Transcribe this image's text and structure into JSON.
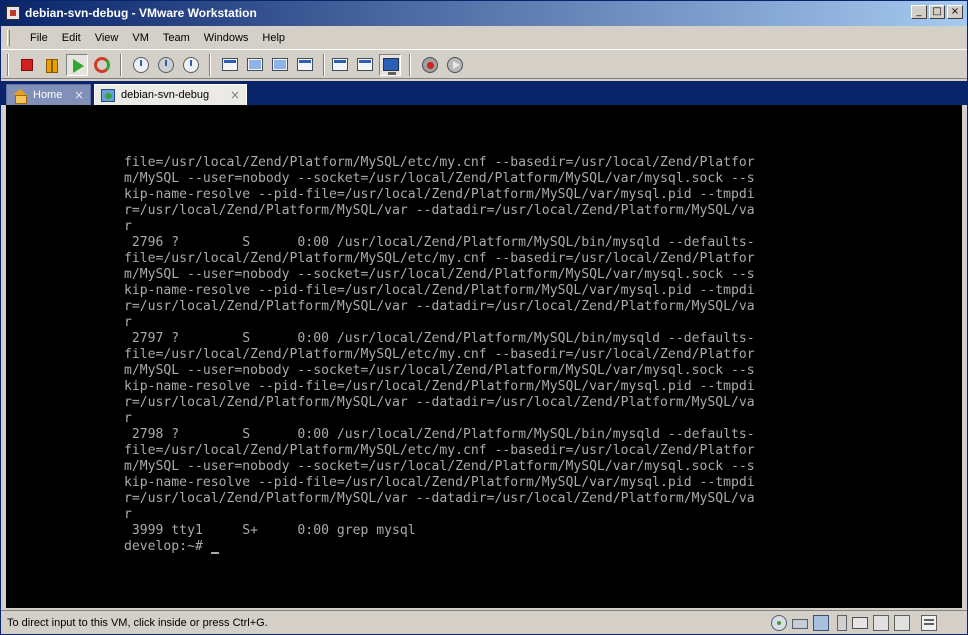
{
  "window": {
    "title": "debian-svn-debug - VMware Workstation",
    "controls": [
      "_",
      "□",
      "×"
    ]
  },
  "menu": [
    "File",
    "Edit",
    "View",
    "VM",
    "Team",
    "Windows",
    "Help"
  ],
  "toolbar": {
    "buttons": [
      {
        "name": "power-off",
        "icon": "stop-icon"
      },
      {
        "name": "suspend",
        "icon": "pause-icon"
      },
      {
        "name": "power-on",
        "icon": "play-icon",
        "pressed": true
      },
      {
        "name": "reset",
        "icon": "reset-icon"
      },
      {
        "name": "take-snapshot",
        "icon": "snapshot-icon"
      },
      {
        "name": "revert-snapshot",
        "icon": "revert-snapshot-icon"
      },
      {
        "name": "snapshot-manager",
        "icon": "snapshot-manager-icon"
      },
      {
        "name": "show-sidebar",
        "icon": "sidebar-icon"
      },
      {
        "name": "quick-switch",
        "icon": "quick-switch-icon"
      },
      {
        "name": "full-screen",
        "icon": "full-screen-icon"
      },
      {
        "name": "unity",
        "icon": "unity-icon"
      },
      {
        "name": "summary-view",
        "icon": "summary-icon"
      },
      {
        "name": "appliance-view",
        "icon": "appliance-icon"
      },
      {
        "name": "console-view",
        "icon": "console-icon",
        "pressed": true
      },
      {
        "name": "record",
        "icon": "record-icon"
      },
      {
        "name": "replay",
        "icon": "replay-icon"
      }
    ]
  },
  "tabs": [
    {
      "label": "Home",
      "icon": "home-icon",
      "active": false
    },
    {
      "label": "debian-svn-debug",
      "icon": "vm-icon",
      "active": true
    }
  ],
  "tab_close_glyph": "×",
  "console": {
    "lines": [
      "file=/usr/local/Zend/Platform/MySQL/etc/my.cnf --basedir=/usr/local/Zend/Platfor",
      "m/MySQL --user=nobody --socket=/usr/local/Zend/Platform/MySQL/var/mysql.sock --s",
      "kip-name-resolve --pid-file=/usr/local/Zend/Platform/MySQL/var/mysql.pid --tmpdi",
      "r=/usr/local/Zend/Platform/MySQL/var --datadir=/usr/local/Zend/Platform/MySQL/va",
      "r",
      " 2796 ?        S      0:00 /usr/local/Zend/Platform/MySQL/bin/mysqld --defaults-",
      "file=/usr/local/Zend/Platform/MySQL/etc/my.cnf --basedir=/usr/local/Zend/Platfor",
      "m/MySQL --user=nobody --socket=/usr/local/Zend/Platform/MySQL/var/mysql.sock --s",
      "kip-name-resolve --pid-file=/usr/local/Zend/Platform/MySQL/var/mysql.pid --tmpdi",
      "r=/usr/local/Zend/Platform/MySQL/var --datadir=/usr/local/Zend/Platform/MySQL/va",
      "r",
      " 2797 ?        S      0:00 /usr/local/Zend/Platform/MySQL/bin/mysqld --defaults-",
      "file=/usr/local/Zend/Platform/MySQL/etc/my.cnf --basedir=/usr/local/Zend/Platfor",
      "m/MySQL --user=nobody --socket=/usr/local/Zend/Platform/MySQL/var/mysql.sock --s",
      "kip-name-resolve --pid-file=/usr/local/Zend/Platform/MySQL/var/mysql.pid --tmpdi",
      "r=/usr/local/Zend/Platform/MySQL/var --datadir=/usr/local/Zend/Platform/MySQL/va",
      "r",
      " 2798 ?        S      0:00 /usr/local/Zend/Platform/MySQL/bin/mysqld --defaults-",
      "file=/usr/local/Zend/Platform/MySQL/etc/my.cnf --basedir=/usr/local/Zend/Platfor",
      "m/MySQL --user=nobody --socket=/usr/local/Zend/Platform/MySQL/var/mysql.sock --s",
      "kip-name-resolve --pid-file=/usr/local/Zend/Platform/MySQL/var/mysql.pid --tmpdi",
      "r=/usr/local/Zend/Platform/MySQL/var --datadir=/usr/local/Zend/Platform/MySQL/va",
      "r",
      " 3999 tty1     S+     0:00 grep mysql"
    ],
    "prompt": "develop:~# ",
    "text_color": "#aaaaaa",
    "background": "#000000"
  },
  "status": {
    "text": "To direct input to this VM, click inside or press Ctrl+G.",
    "device_icons": [
      "cd-icon",
      "hdd-icon",
      "network-icon",
      "usb-icon",
      "printer-icon",
      "sound-icon",
      "floppy-icon",
      "message-icon"
    ]
  }
}
